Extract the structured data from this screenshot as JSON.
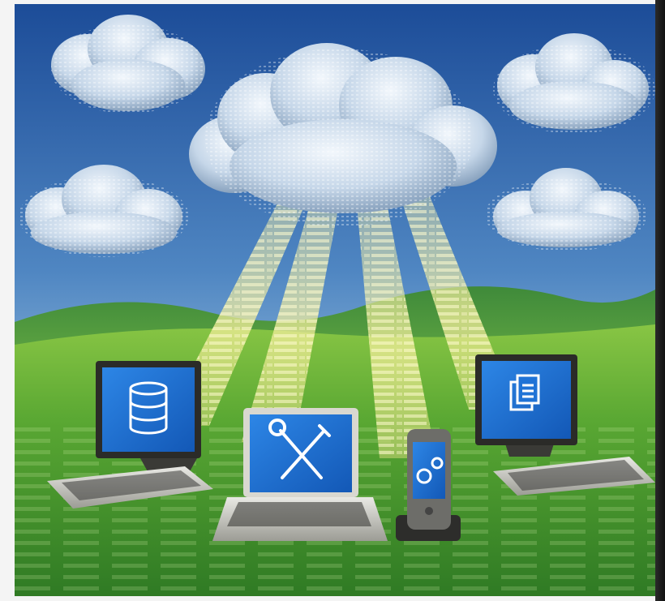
{
  "colors": {
    "sky_top": "#1d4f9c",
    "sky_mid": "#5f94c9",
    "sky_horizon": "#bcd6e8",
    "hill_far": "#3f8a3a",
    "grass_near": "#3f8f2c",
    "grass_far": "#7cbb3f",
    "code_glow": "#f4f0a0",
    "screen_blue": "#1c6fd1",
    "cloud_light": "#e3edf7",
    "cloud_shadow": "#6a88a8"
  },
  "icons": {
    "desktop_left_screen": "database-icon",
    "laptop_screen": "tools-icon",
    "phone_screen": "gears-icon",
    "desktop_right_screen": "documents-icon"
  }
}
